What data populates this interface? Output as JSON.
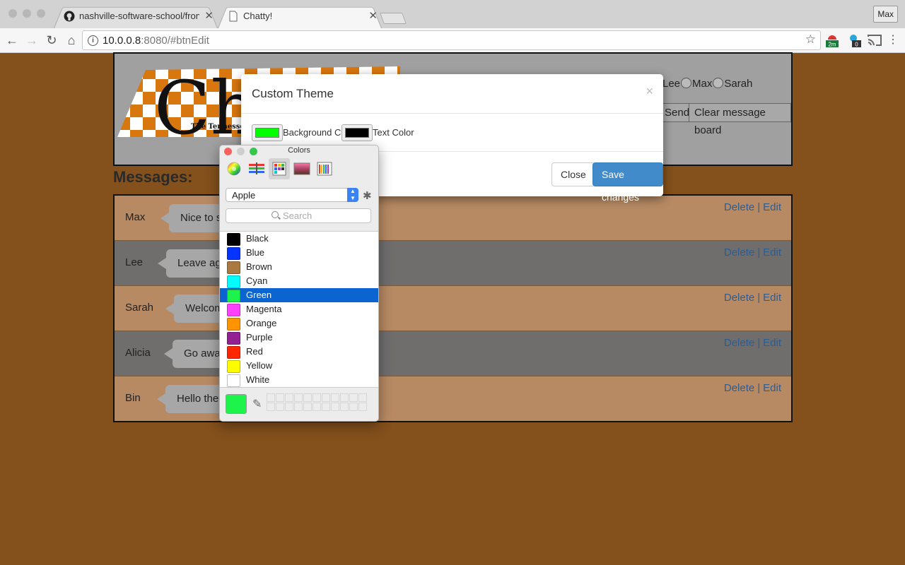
{
  "browser": {
    "tabs": [
      {
        "title": "nashville-software-school/fron",
        "active": false
      },
      {
        "title": "Chatty!",
        "active": true
      }
    ],
    "profile": "Max",
    "url_host": "10.0.0.8",
    "url_rest": ":8080/#btnEdit",
    "extensions": [
      {
        "badge": "2m"
      },
      {
        "badge": "0"
      }
    ]
  },
  "header": {
    "logo_text": "Chat",
    "logo_tagline": "The Tennesse",
    "users": [
      "Lee",
      "Max",
      "Sarah"
    ],
    "send_label": "Send",
    "clear_label": "Clear message board"
  },
  "messages_title": "Messages:",
  "messages": [
    {
      "author": "Max",
      "text": "Nice to se",
      "delete": "Delete",
      "edit": "Edit"
    },
    {
      "author": "Lee",
      "text": "Leave agai",
      "delete": "Delete",
      "edit": "Edit"
    },
    {
      "author": "Sarah",
      "text": "Welcom",
      "delete": "Delete",
      "edit": "Edit"
    },
    {
      "author": "Alicia",
      "text": "Go away!",
      "delete": "Delete",
      "edit": "Edit"
    },
    {
      "author": "Bin",
      "text": "Hello there",
      "delete": "Delete",
      "edit": "Edit"
    }
  ],
  "modal": {
    "title": "Custom Theme",
    "close_x": "×",
    "bg_label": "Background Color",
    "text_label": "Text Color",
    "bg_color": "#00ff00",
    "text_color": "#000000",
    "close_button": "Close",
    "save_button": "Save changes"
  },
  "colors_panel": {
    "title": "Colors",
    "list_name": "Apple",
    "search_placeholder": "Search",
    "current_color": "#1ef34c",
    "colors": [
      {
        "name": "Black",
        "hex": "#000000"
      },
      {
        "name": "Blue",
        "hex": "#0533ff"
      },
      {
        "name": "Brown",
        "hex": "#aa7942"
      },
      {
        "name": "Cyan",
        "hex": "#00fdff"
      },
      {
        "name": "Green",
        "hex": "#1ef34c",
        "selected": true
      },
      {
        "name": "Magenta",
        "hex": "#ff40ff"
      },
      {
        "name": "Orange",
        "hex": "#ff9300"
      },
      {
        "name": "Purple",
        "hex": "#942192"
      },
      {
        "name": "Red",
        "hex": "#ff2600"
      },
      {
        "name": "Yellow",
        "hex": "#fffb00"
      },
      {
        "name": "White",
        "hex": "#ffffff"
      }
    ]
  }
}
